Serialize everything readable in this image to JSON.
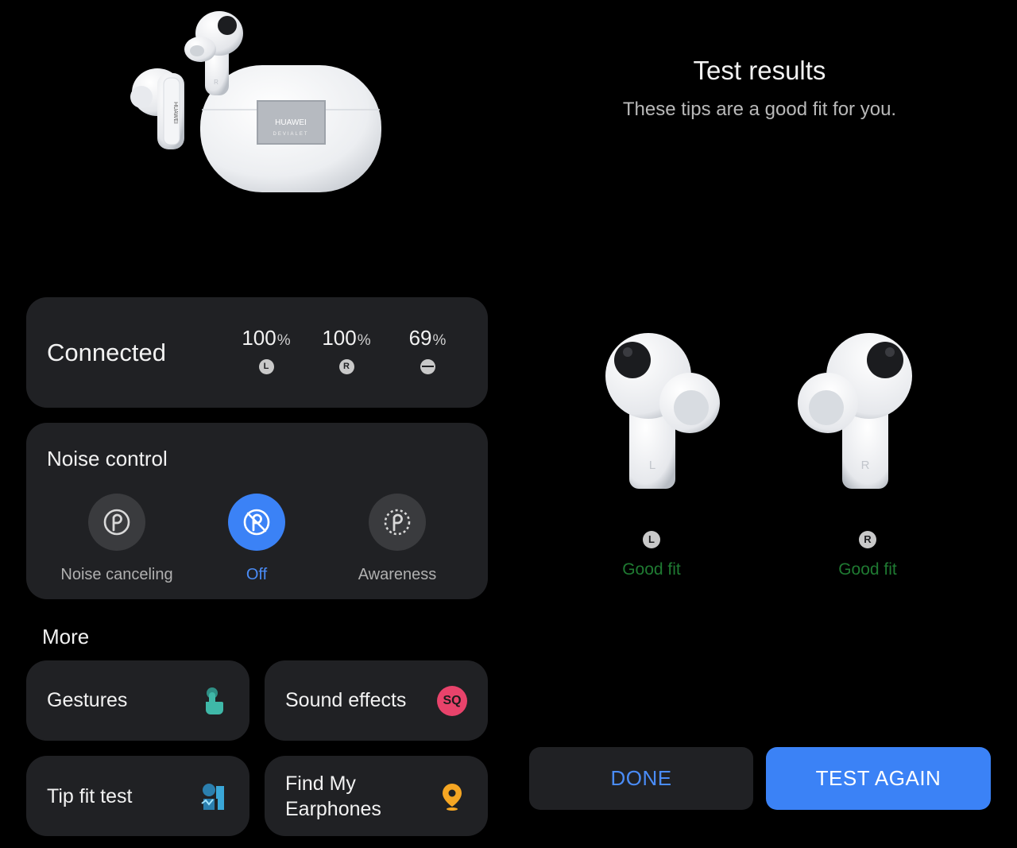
{
  "product": {
    "case_brand": "HUAWEI",
    "case_sub": "DEVIALET",
    "stem_brand": "HUAWEI",
    "right_mark": "R"
  },
  "connected": {
    "status": "Connected",
    "batteries": [
      {
        "value": "100",
        "unit": "%",
        "badge": "L",
        "icon": "left-earbud-icon"
      },
      {
        "value": "100",
        "unit": "%",
        "badge": "R",
        "icon": "right-earbud-icon"
      },
      {
        "value": "69",
        "unit": "%",
        "badge": "",
        "icon": "case-icon"
      }
    ]
  },
  "noise_control": {
    "title": "Noise control",
    "selected": "Off",
    "modes": [
      {
        "label": "Noise canceling",
        "icon": "noise-canceling-icon",
        "active": false
      },
      {
        "label": "Off",
        "icon": "noise-off-icon",
        "active": true
      },
      {
        "label": "Awareness",
        "icon": "awareness-icon",
        "active": false
      }
    ]
  },
  "more": {
    "title": "More",
    "tiles": [
      {
        "label": "Gestures",
        "icon": "gesture-hand-icon",
        "color": "#3fb8a8"
      },
      {
        "label": "Sound effects",
        "icon": "sq-badge-icon",
        "badge": "SQ",
        "color": "#e8436b"
      },
      {
        "label": "Tip fit test",
        "icon": "tip-fit-icon",
        "color": "#3aa7d8"
      },
      {
        "label_line1": "Find My",
        "label_line2": "Earphones",
        "icon": "location-pin-icon",
        "color": "#f5a623"
      }
    ]
  },
  "results": {
    "title": "Test results",
    "subtitle": "These tips are a good fit for you.",
    "left": {
      "badge": "L",
      "fit": "Good fit",
      "stem_mark": "L"
    },
    "right": {
      "badge": "R",
      "fit": "Good fit",
      "stem_mark": "R"
    }
  },
  "actions": {
    "done": "DONE",
    "test_again": "TEST AGAIN"
  },
  "colors": {
    "accent": "#3b82f6",
    "card": "#202124",
    "good_fit": "#1f7a32"
  }
}
